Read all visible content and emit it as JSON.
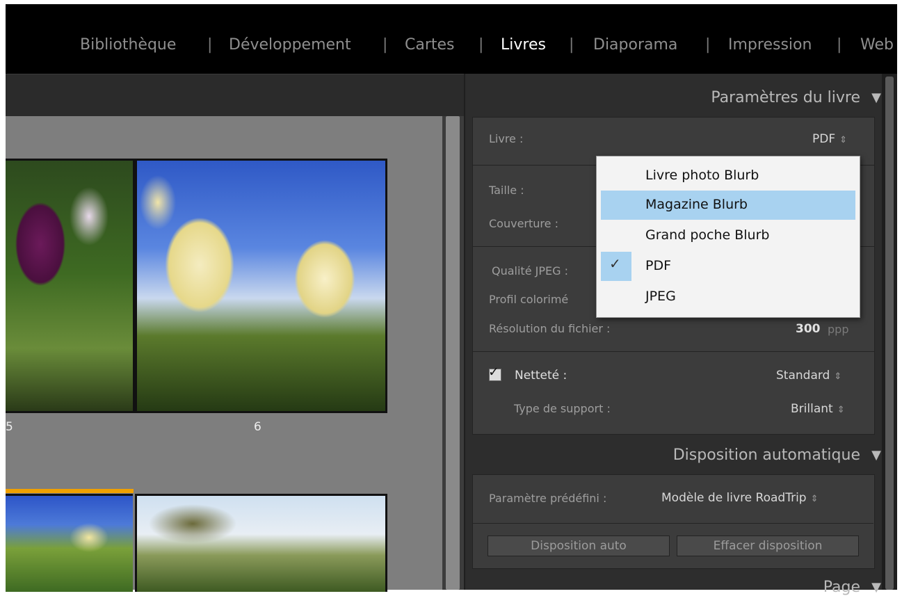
{
  "modules": [
    {
      "label": "Bibliothèque",
      "active": false
    },
    {
      "label": "Développement",
      "active": false
    },
    {
      "label": "Cartes",
      "active": false
    },
    {
      "label": "Livres",
      "active": true
    },
    {
      "label": "Diaporama",
      "active": false
    },
    {
      "label": "Impression",
      "active": false
    },
    {
      "label": "Web",
      "active": false
    }
  ],
  "separator": "|",
  "canvas": {
    "page_num_left": "5",
    "page_num_right": "6"
  },
  "panel": {
    "book_settings_header": "Paramètres du livre",
    "book_label": "Livre :",
    "book_value": "PDF",
    "size_label": "Taille :",
    "cover_label": "Couverture :",
    "jpeg_quality_label": "Qualité JPEG :",
    "color_profile_label": "Profil colorimé",
    "resolution_label": "Résolution du fichier :",
    "resolution_value": "300",
    "resolution_unit": "ppp",
    "sharpening_label": "Netteté :",
    "sharpening_value": "Standard",
    "media_label": "Type de support :",
    "media_value": "Brillant",
    "auto_layout_header": "Disposition automatique",
    "preset_label": "Paramètre prédéfini :",
    "preset_value": "Modèle de livre RoadTrip",
    "auto_layout_button": "Disposition auto",
    "clear_layout_button": "Effacer disposition",
    "page_header": "Page"
  },
  "dropdown": {
    "options": [
      {
        "label": "Livre photo Blurb",
        "highlighted": false,
        "checked": false
      },
      {
        "label": "Magazine Blurb",
        "highlighted": true,
        "checked": false
      },
      {
        "label": "Grand poche Blurb",
        "highlighted": false,
        "checked": false
      },
      {
        "label": "PDF",
        "highlighted": false,
        "checked": true
      },
      {
        "label": "JPEG",
        "highlighted": false,
        "checked": false
      }
    ]
  },
  "icons": {
    "collapse": "triangle-down-icon",
    "stepper": "updown-arrows-icon",
    "check": "checkmark-icon"
  },
  "colors": {
    "highlight": "#a8d2f0",
    "panel": "#2d2d2d",
    "section": "#3c3c3c",
    "canvas": "#7e7e7e",
    "active_page_border": "#f0a000"
  }
}
